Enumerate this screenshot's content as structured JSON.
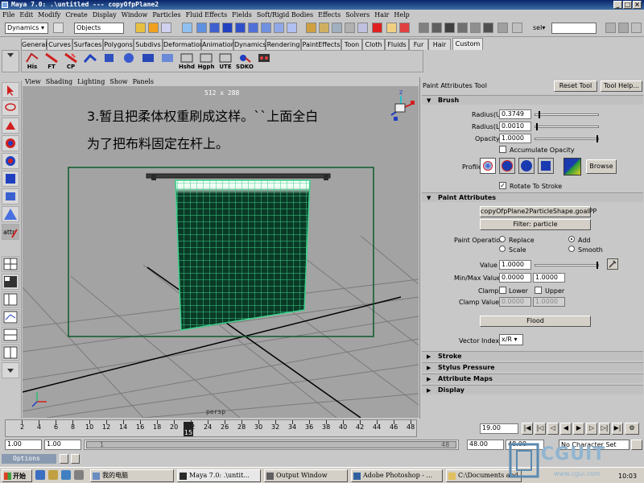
{
  "window": {
    "title": "Maya 7.0: .\\untitled   ---   copyOfpPlane2"
  },
  "menubar": [
    "File",
    "Edit",
    "Modify",
    "Create",
    "Display",
    "Window",
    "Particles",
    "Fluid Effects",
    "Fields",
    "Soft/Rigid Bodies",
    "Effects",
    "Solvers",
    "Hair",
    "Help"
  ],
  "statusline": {
    "mode": "Dynamics",
    "objects_field": "Objects",
    "sel_label": "sel▾"
  },
  "shelf_tabs": [
    "General",
    "Curves",
    "Surfaces",
    "Polygons",
    "Subdivs",
    "Deformation",
    "Animation",
    "Dynamics",
    "Rendering",
    "PaintEffects",
    "Toon",
    "Cloth",
    "Fluids",
    "Fur",
    "Hair",
    "Custom"
  ],
  "shelf_active": "Custom",
  "shelf_buttons": [
    {
      "label": "His",
      "icon": "history-icon"
    },
    {
      "label": "FT",
      "icon": "freeze-transform-icon"
    },
    {
      "label": "CP",
      "icon": "center-pivot-icon"
    },
    {
      "label": "",
      "icon": "ik-chain-icon"
    },
    {
      "label": "",
      "icon": "polygon-cube-icon"
    },
    {
      "label": "",
      "icon": "polygon-sphere-icon"
    },
    {
      "label": "",
      "icon": "combine-icon"
    },
    {
      "label": "",
      "icon": "mesh-icon"
    },
    {
      "label": "Hshd",
      "icon": "hypershade-icon"
    },
    {
      "label": "Hgph",
      "icon": "hypergraph-icon"
    },
    {
      "label": "UTE",
      "icon": "uv-texture-editor-icon"
    },
    {
      "label": "SDKO",
      "icon": "set-driven-key-icon"
    },
    {
      "label": "",
      "icon": "render-settings-icon"
    }
  ],
  "viewport": {
    "menu": [
      "View",
      "Shading",
      "Lighting",
      "Show",
      "Panels"
    ],
    "resolution": "512 x 288",
    "camera": "persp",
    "annotation_line1": "3.暂且把柔体权重刷成这样。``上面全白",
    "annotation_line2": "为了把布料固定在杆上。"
  },
  "attr": {
    "title": "Paint Attributes Tool",
    "reset_tool": "Reset Tool",
    "tool_help": "Tool Help...",
    "brush_section": "Brush",
    "radius_u_label": "Radius(U)",
    "radius_u": "0.3749",
    "radius_l_label": "Radius(L)",
    "radius_l": "0.0010",
    "opacity_label": "Opacity",
    "opacity": "1.0000",
    "accumulate_opacity": "Accumulate Opacity",
    "profile_label": "Profile",
    "browse": "Browse",
    "rotate_to_stroke": "Rotate To Stroke",
    "paint_attributes_section": "Paint Attributes",
    "attribute_button": "copyOfpPlane2ParticleShape.goalPP",
    "filter_button": "Filter: particle",
    "paint_operation_label": "Paint Operation",
    "ops": [
      "Replace",
      "Add",
      "Scale",
      "Smooth"
    ],
    "selected_op": "Add",
    "value_label": "Value",
    "value": "1.0000",
    "minmax_label": "Min/Max Value",
    "min_value": "0.0000",
    "max_value": "1.0000",
    "clamp_label": "Clamp",
    "clamp_lower": "Lower",
    "clamp_upper": "Upper",
    "clamp_values_label": "Clamp Values",
    "clamp_low_value": "0.0000",
    "clamp_high_value": "1.0000",
    "flood": "Flood",
    "vector_index_label": "Vector Index",
    "vector_index": "x/R",
    "collapsed_sections": [
      "Stroke",
      "Stylus Pressure",
      "Attribute Maps",
      "Display"
    ]
  },
  "timeline": {
    "ticks": [
      "2",
      "4",
      "6",
      "8",
      "10",
      "12",
      "14",
      "16",
      "18",
      "20",
      "22",
      "24",
      "26",
      "28",
      "30",
      "32",
      "34",
      "36",
      "38",
      "40",
      "42",
      "44",
      "46",
      "48"
    ],
    "current_frame": "15",
    "current_time_field": "19.00"
  },
  "range": {
    "start": "1.00",
    "playback_start": "1.00",
    "slider_start": "1",
    "slider_end": "48",
    "playback_end": "48.00",
    "end": "48.00",
    "character_set": "No Character Set"
  },
  "cmdline": {
    "label": "Options"
  },
  "taskbar": {
    "start": "开始",
    "items": [
      "我的电脑",
      "Maya 7.0: .\\untit...",
      "Output Window",
      "Adobe Photoshop - ...",
      "C:\\Documents and S..."
    ],
    "clock": "10:03"
  },
  "watermark": {
    "text": "CGUIT",
    "url": "www.cgui.com"
  },
  "colors": {
    "mesh": "#3cd08c",
    "mesh_cells": "#0a3a26",
    "selection_box": "#0c5a2c",
    "viewport_bg": "#a3a3a3",
    "title_bar": "#0a246a"
  }
}
